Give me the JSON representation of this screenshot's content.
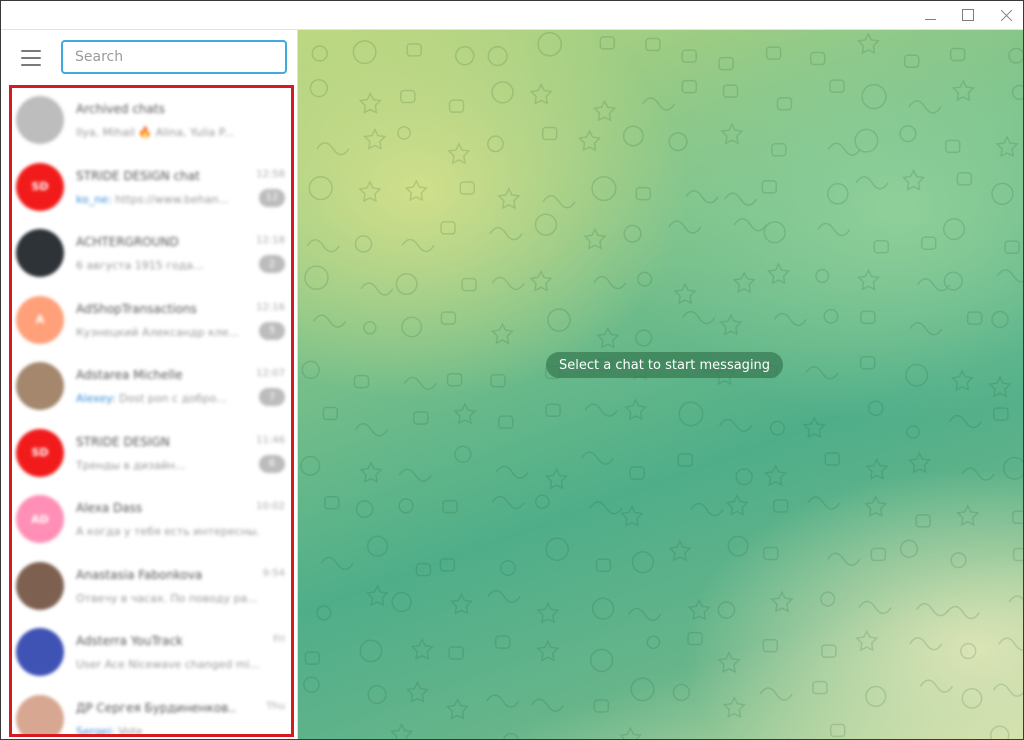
{
  "window": {
    "controls": [
      "minimize",
      "maximize",
      "close"
    ]
  },
  "search": {
    "placeholder": "Search"
  },
  "chats": [
    {
      "name": "Archived chats",
      "time": "",
      "preview": "Ilya, Mihail 🔥 Alina, Yulia P...",
      "sender": "",
      "badge": "",
      "avatar_color": "#bdbdbd",
      "avatar_text": ""
    },
    {
      "name": "STRIDE DESIGN chat",
      "time": "12:58",
      "preview": "https://www.behan...",
      "sender": "ko_ne:",
      "badge": "12",
      "avatar_color": "#f21b1b",
      "avatar_text": "SD"
    },
    {
      "name": "ACHTERGROUND",
      "time": "12:18",
      "preview": "6 августа 1915 года...",
      "sender": "",
      "badge": "2",
      "avatar_color": "#2e3338",
      "avatar_text": ""
    },
    {
      "name": "AdShopTransactions",
      "time": "12:16",
      "preview": "Кузнецкий Александр кле...",
      "sender": "",
      "badge": "5",
      "avatar_color": "#ffa07a",
      "avatar_text": "A"
    },
    {
      "name": "Adstarea Michelle",
      "time": "12:07",
      "preview": "Dost pon с добро...",
      "sender": "Alexey:",
      "badge": "7",
      "avatar_color": "#a4876c",
      "avatar_text": ""
    },
    {
      "name": "STRIDE DESIGN",
      "time": "11:46",
      "preview": "Тренды в дизайн...",
      "sender": "",
      "badge": "6",
      "avatar_color": "#f21b1b",
      "avatar_text": "SD"
    },
    {
      "name": "Alexa Dass",
      "time": "10:02",
      "preview": "А когда у тебя есть интересны...",
      "sender": "",
      "badge": "",
      "avatar_color": "#ff8fb6",
      "avatar_text": "AD"
    },
    {
      "name": "Anastasia Fabonkova",
      "time": "9:54",
      "preview": "Отвечу в часах. По поводу ра...",
      "sender": "",
      "badge": "",
      "avatar_color": "#7e6050",
      "avatar_text": ""
    },
    {
      "name": "Adsterra YouTrack",
      "time": "Fri",
      "preview": "User Ace Nicewave changed mi...",
      "sender": "",
      "badge": "",
      "avatar_color": "#3f53b5",
      "avatar_text": ""
    },
    {
      "name": "ДР Сергея Бурдиненков...",
      "time": "Thu",
      "preview": "Vote",
      "sender": "Sergei:",
      "badge": "",
      "avatar_color": "#d7a791",
      "avatar_text": ""
    }
  ],
  "main": {
    "empty_message": "Select a chat to start messaging"
  }
}
